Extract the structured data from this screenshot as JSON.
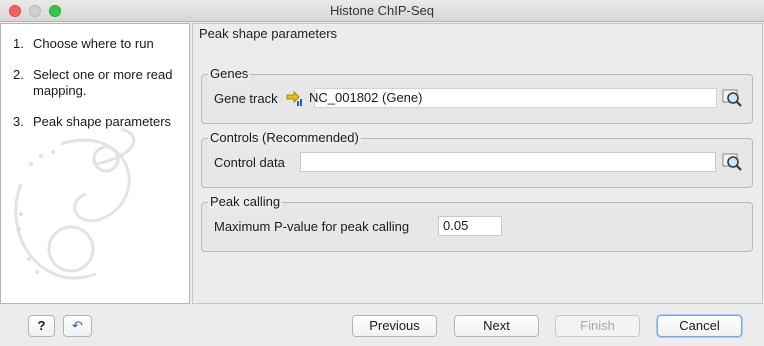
{
  "window": {
    "title": "Histone ChIP-Seq"
  },
  "steps": [
    {
      "num": "1.",
      "label": "Choose where to run"
    },
    {
      "num": "2.",
      "label": "Select one or more read mapping."
    },
    {
      "num": "3.",
      "label": "Peak shape parameters"
    }
  ],
  "panel": {
    "title": "Peak shape parameters",
    "genes": {
      "group_title": "Genes",
      "label": "Gene track",
      "value": "NC_001802 (Gene)",
      "icon": "track-icon"
    },
    "controls": {
      "group_title": "Controls (Recommended)",
      "label": "Control data",
      "value": ""
    },
    "peak": {
      "group_title": "Peak calling",
      "label": "Maximum P-value for peak calling",
      "value": "0.05"
    }
  },
  "buttons": {
    "help": "?",
    "reset": "↶",
    "previous": "Previous",
    "next": "Next",
    "finish": "Finish",
    "cancel": "Cancel"
  },
  "colors": {
    "close": "#fc605c",
    "minimize": "#d0d0d0",
    "maximize": "#34c84a",
    "focus": "#7aa7e9"
  }
}
